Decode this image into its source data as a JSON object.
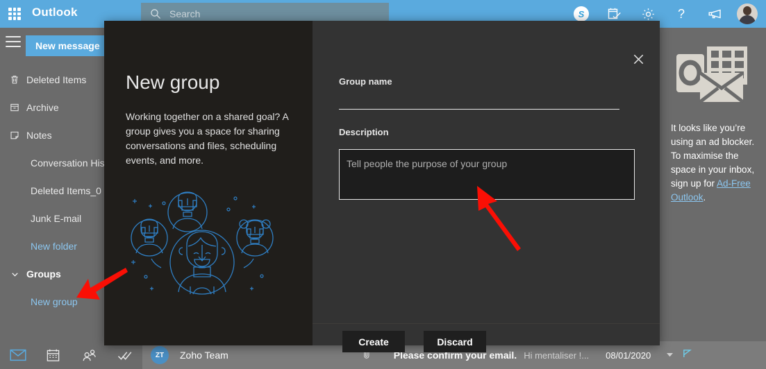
{
  "topbar": {
    "brand": "Outlook",
    "waffle_icon": "app-launcher-icon",
    "search": {
      "placeholder": "Search",
      "icon": "search-icon"
    },
    "icons": [
      {
        "name": "skype-icon",
        "glyph": "S"
      },
      {
        "name": "tasks-calendar-check-icon"
      },
      {
        "name": "settings-gear-icon"
      },
      {
        "name": "help-question-icon"
      },
      {
        "name": "feedback-megaphone-icon"
      }
    ],
    "avatar_label": "account-avatar"
  },
  "sidebar": {
    "hamburger_icon": "hamburger-menu-icon",
    "new_message_label": "New message",
    "folders": [
      {
        "label": "Deleted Items",
        "icon": "trash-icon",
        "style": "normal"
      },
      {
        "label": "Archive",
        "icon": "archive-box-icon",
        "style": "normal"
      },
      {
        "label": "Notes",
        "icon": "note-icon",
        "style": "normal"
      },
      {
        "label": "Conversation His",
        "icon": "",
        "style": "normal"
      },
      {
        "label": "Deleted Items_0",
        "icon": "",
        "style": "normal"
      },
      {
        "label": "Junk E-mail",
        "icon": "",
        "style": "normal"
      },
      {
        "label": "New folder",
        "icon": "",
        "style": "link"
      },
      {
        "label": "Groups",
        "icon": "chevron-down-icon",
        "style": "bold"
      },
      {
        "label": "New group",
        "icon": "",
        "style": "link"
      }
    ]
  },
  "bottom_nav": [
    {
      "name": "mail-icon",
      "active": true
    },
    {
      "name": "calendar-icon",
      "active": false
    },
    {
      "name": "people-icon",
      "active": false
    },
    {
      "name": "todo-check-icon",
      "active": false
    }
  ],
  "message_strip": {
    "avatar_initials": "ZT",
    "sender": "Zoho Team",
    "attachment_icon": "paperclip-icon",
    "subject": "Please confirm your email.",
    "preview": "Hi mentaliser !...",
    "date": "08/01/2020",
    "caret_icon": "caret-down-icon",
    "flag_icon": "flag-icon"
  },
  "ad_panel": {
    "logo_icon": "outlook-logo-icon",
    "text_before": "It looks like you’re using an ad blocker. To maximise the space in your inbox, sign up for ",
    "link_text": "Ad-Free Outlook",
    "text_after": "."
  },
  "dialog": {
    "title": "New group",
    "body": "Working together on a shared goal? A group gives you a space for sharing conversations and files, scheduling events, and more.",
    "illustration_name": "group-of-people-illustration",
    "close_icon": "close-icon",
    "group_name_label": "Group name",
    "group_name_value": "",
    "group_name_placeholder": "",
    "description_label": "Description",
    "description_value": "",
    "description_placeholder": "Tell people the purpose of your group",
    "create_label": "Create",
    "discard_label": "Discard"
  },
  "annotations": [
    {
      "name": "red-arrow-to-description",
      "color": "#fa0f05"
    },
    {
      "name": "red-arrow-to-new-group",
      "color": "#fa0f05"
    }
  ],
  "colors": {
    "accent_blue": "#5aaade",
    "link_blue": "#8cc6ef",
    "sidebar_gray": "#6b6b6b",
    "dialog_left": "#201e1b",
    "dialog_right": "#333333",
    "arrow_red": "#fa0f05"
  }
}
